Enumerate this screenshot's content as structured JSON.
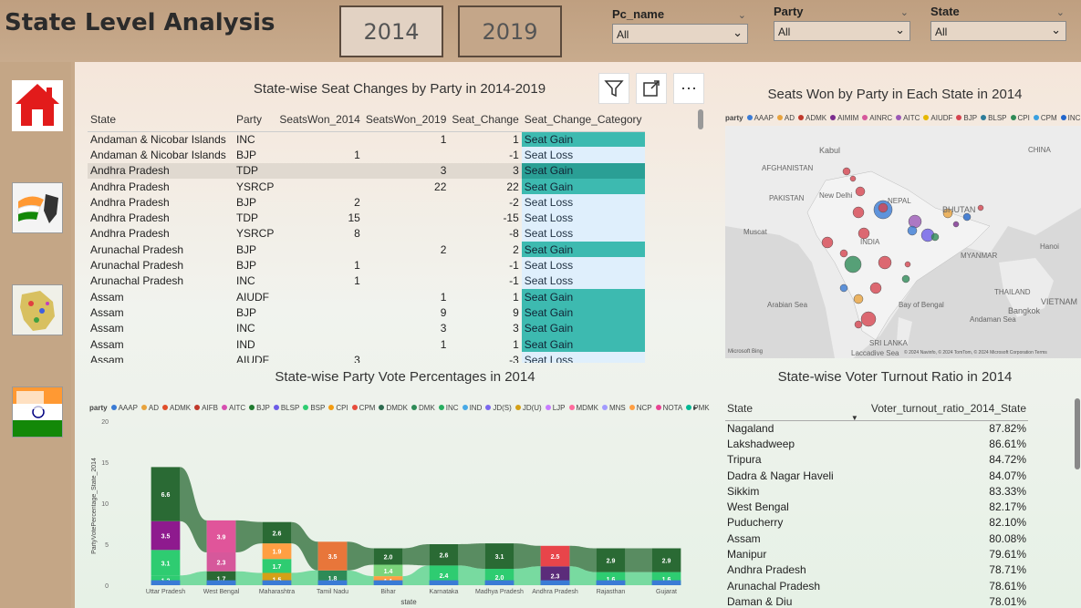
{
  "header": {
    "title": "State Level Analysis",
    "year_a": "2014",
    "year_b": "2019"
  },
  "slicers": [
    {
      "label": "Pc_name",
      "value": "All"
    },
    {
      "label": "Party",
      "value": "All"
    },
    {
      "label": "State",
      "value": "All"
    }
  ],
  "seat_table": {
    "title": "State-wise Seat Changes by Party in 2014-2019",
    "columns": [
      "State",
      "Party",
      "SeatsWon_2014",
      "SeatsWon_2019",
      "Seat_Change",
      "Seat_Change_Category"
    ],
    "rows": [
      [
        "Andaman & Nicobar Islands",
        "INC",
        "",
        "1",
        "1",
        "Seat Gain"
      ],
      [
        "Andaman & Nicobar Islands",
        "BJP",
        "1",
        "",
        "-1",
        "Seat Loss"
      ],
      [
        "Andhra Pradesh",
        "TDP",
        "",
        "3",
        "3",
        "Seat Gain"
      ],
      [
        "Andhra Pradesh",
        "YSRCP",
        "",
        "22",
        "22",
        "Seat Gain"
      ],
      [
        "Andhra Pradesh",
        "BJP",
        "2",
        "",
        "-2",
        "Seat Loss"
      ],
      [
        "Andhra Pradesh",
        "TDP",
        "15",
        "",
        "-15",
        "Seat Loss"
      ],
      [
        "Andhra Pradesh",
        "YSRCP",
        "8",
        "",
        "-8",
        "Seat Loss"
      ],
      [
        "Arunachal Pradesh",
        "BJP",
        "",
        "2",
        "2",
        "Seat Gain"
      ],
      [
        "Arunachal Pradesh",
        "BJP",
        "1",
        "",
        "-1",
        "Seat Loss"
      ],
      [
        "Arunachal Pradesh",
        "INC",
        "1",
        "",
        "-1",
        "Seat Loss"
      ],
      [
        "Assam",
        "AIUDF",
        "",
        "1",
        "1",
        "Seat Gain"
      ],
      [
        "Assam",
        "BJP",
        "",
        "9",
        "9",
        "Seat Gain"
      ],
      [
        "Assam",
        "INC",
        "",
        "3",
        "3",
        "Seat Gain"
      ],
      [
        "Assam",
        "IND",
        "",
        "1",
        "1",
        "Seat Gain"
      ],
      [
        "Assam",
        "AIUDF",
        "3",
        "",
        "-3",
        "Seat Loss"
      ]
    ],
    "highlight_row": 2
  },
  "map": {
    "title": "Seats Won by Party in Each State in 2014",
    "legend_title": "party",
    "legend": [
      "AAAP",
      "AD",
      "ADMK",
      "AIMIM",
      "AINRC",
      "AITC",
      "AIUDF",
      "BJP",
      "BLSP",
      "CPI",
      "CPM",
      "INC"
    ],
    "legend_colors": [
      "#3a7bd5",
      "#e8a33d",
      "#c0392b",
      "#7b2d8e",
      "#d6589b",
      "#9b59b6",
      "#e6b800",
      "#d64550",
      "#2d7d9a",
      "#2e8b57",
      "#3aa0e0",
      "#2266cc"
    ],
    "labels": [
      "Kabul",
      "AFGHANISTAN",
      "PAKISTAN",
      "New Delhi",
      "CHINA",
      "NEPAL",
      "BHUTAN",
      "INDIA",
      "Muscat",
      "MYANMAR",
      "Hanoi",
      "THAILAND",
      "Bangkok",
      "Arabian Sea",
      "Bay of Bengal",
      "Andaman Sea",
      "SRI LANKA",
      "Laccadive Sea",
      "VIETNAM"
    ],
    "attribution": "© 2024 Navinfo, © 2024 TomTom, © 2024 Microsoft Corporation Terms",
    "brand": "Microsoft Bing"
  },
  "vote_chart": {
    "title": "State-wise Party Vote Percentages in 2014",
    "legend_title": "party",
    "legend": [
      "AAAP",
      "AD",
      "ADMK",
      "AIFB",
      "AITC",
      "BJP",
      "BLSP",
      "BSP",
      "CPI",
      "CPM",
      "DMDK",
      "DMK",
      "INC",
      "IND",
      "JD(S)",
      "JD(U)",
      "LJP",
      "MDMK",
      "MNS",
      "NCP",
      "NOTA",
      "PMK"
    ],
    "legend_colors": [
      "#3a7bd5",
      "#e8a33d",
      "#e04e2a",
      "#c0392b",
      "#d64fb0",
      "#1e7a2e",
      "#6c5ce7",
      "#2ecc71",
      "#f39c12",
      "#e74c3c",
      "#2d6a4f",
      "#2e8b57",
      "#27ae60",
      "#48a9e6",
      "#7b68ee",
      "#d4a017",
      "#c77dff",
      "#ff6b9d",
      "#a29bfe",
      "#ff9f43",
      "#e84393",
      "#00b894"
    ],
    "ylabel": "PartyVotePercentage_State_2014",
    "xlabel": "state",
    "yticks": [
      "0",
      "5",
      "10",
      "15",
      "20"
    ]
  },
  "chart_data": {
    "type": "area",
    "title": "State-wise Party Vote Percentages in 2014",
    "xlabel": "state",
    "ylabel": "PartyVotePercentage_State_2014",
    "ylim": [
      0,
      20
    ],
    "categories": [
      "Uttar Pradesh",
      "West Bengal",
      "Maharashtra",
      "Tamil Nadu",
      "Bihar",
      "Karnataka",
      "Madhya Pradesh",
      "Andhra Pradesh",
      "Rajasthan",
      "Gujarat"
    ],
    "segments": [
      [
        {
          "v": 1.2,
          "c": "#2ecc71"
        },
        {
          "v": 3.1,
          "c": "#2ecc71"
        },
        {
          "v": 3.5,
          "c": "#8e1a8e"
        },
        {
          "v": 6.6,
          "c": "#2a6a34"
        }
      ],
      [
        {
          "v": 1.7,
          "c": "#2a6a34"
        },
        {
          "v": 2.3,
          "c": "#d6589b"
        },
        {
          "v": 3.9,
          "c": "#e0559a"
        }
      ],
      [
        {
          "v": 1.5,
          "c": "#d4a017"
        },
        {
          "v": 1.7,
          "c": "#2ecc71"
        },
        {
          "v": 1.9,
          "c": "#ff9f43"
        },
        {
          "v": 2.6,
          "c": "#2a6a34"
        }
      ],
      [
        {
          "v": 1.8,
          "c": "#2e8b57"
        },
        {
          "v": 3.5,
          "c": "#e8763a"
        }
      ],
      [
        {
          "v": 1.1,
          "c": "#ff9f43"
        },
        {
          "v": 1.4,
          "c": "#7bd47b"
        },
        {
          "v": 2.0,
          "c": "#2a6a34"
        }
      ],
      [
        {
          "v": 2.4,
          "c": "#2ecc71"
        },
        {
          "v": 2.6,
          "c": "#2a6a34"
        }
      ],
      [
        {
          "v": 2.0,
          "c": "#2ecc71"
        },
        {
          "v": 3.1,
          "c": "#2a6a34"
        }
      ],
      [
        {
          "v": 2.3,
          "c": "#5b2c7a"
        },
        {
          "v": 2.5,
          "c": "#e8454a"
        }
      ],
      [
        {
          "v": 1.6,
          "c": "#2ecc71"
        },
        {
          "v": 2.9,
          "c": "#2a6a34"
        }
      ],
      [
        {
          "v": 1.6,
          "c": "#2ecc71"
        },
        {
          "v": 2.9,
          "c": "#2a6a34"
        }
      ]
    ]
  },
  "turnout": {
    "title": "State-wise Voter Turnout Ratio in 2014",
    "columns": [
      "State",
      "Voter_turnout_ratio_2014_State"
    ],
    "rows": [
      [
        "Nagaland",
        "87.82%"
      ],
      [
        "Lakshadweep",
        "86.61%"
      ],
      [
        "Tripura",
        "84.72%"
      ],
      [
        "Dadra & Nagar Haveli",
        "84.07%"
      ],
      [
        "Sikkim",
        "83.33%"
      ],
      [
        "West Bengal",
        "82.17%"
      ],
      [
        "Puducherry",
        "82.10%"
      ],
      [
        "Assam",
        "80.08%"
      ],
      [
        "Manipur",
        "79.61%"
      ],
      [
        "Andhra Pradesh",
        "78.71%"
      ],
      [
        "Arunachal Pradesh",
        "78.61%"
      ],
      [
        "Daman & Diu",
        "78.01%"
      ]
    ]
  }
}
